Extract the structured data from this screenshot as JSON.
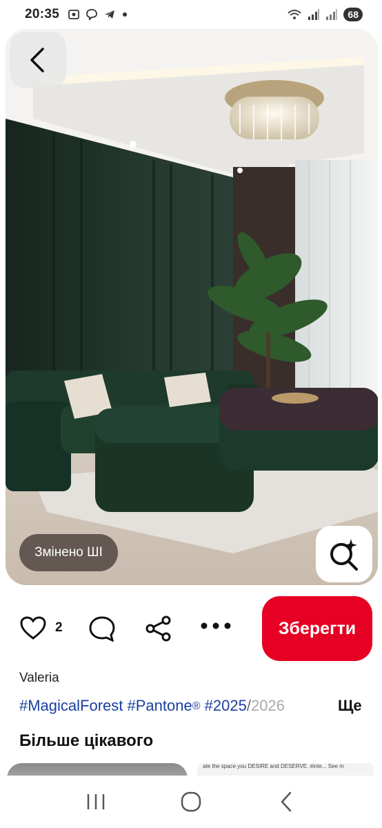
{
  "status_bar": {
    "time": "20:35",
    "battery": "68"
  },
  "pin": {
    "ai_badge": "Змінено ШІ",
    "like_count": "2",
    "save_label": "Зберегти",
    "author": "Valeria",
    "tags": [
      "#MagicalForest",
      "#Pantone",
      "®",
      "#2025",
      "/",
      "2026"
    ],
    "more_label": "Ще"
  },
  "more_section": {
    "title": "Більше цікавого",
    "right_thumb_caption": "ate the space you DESIRE and DESERVE. #inte... See m"
  },
  "icons": {
    "back": "chevron-left-icon",
    "visual_search": "sparkle-search-icon",
    "like": "heart-icon",
    "comment": "comment-icon",
    "share": "share-icon",
    "more": "more-dots-icon"
  },
  "colors": {
    "save_button": "#e60023",
    "tag_link": "#1a3fa0",
    "wall": "#1f3a2e"
  }
}
